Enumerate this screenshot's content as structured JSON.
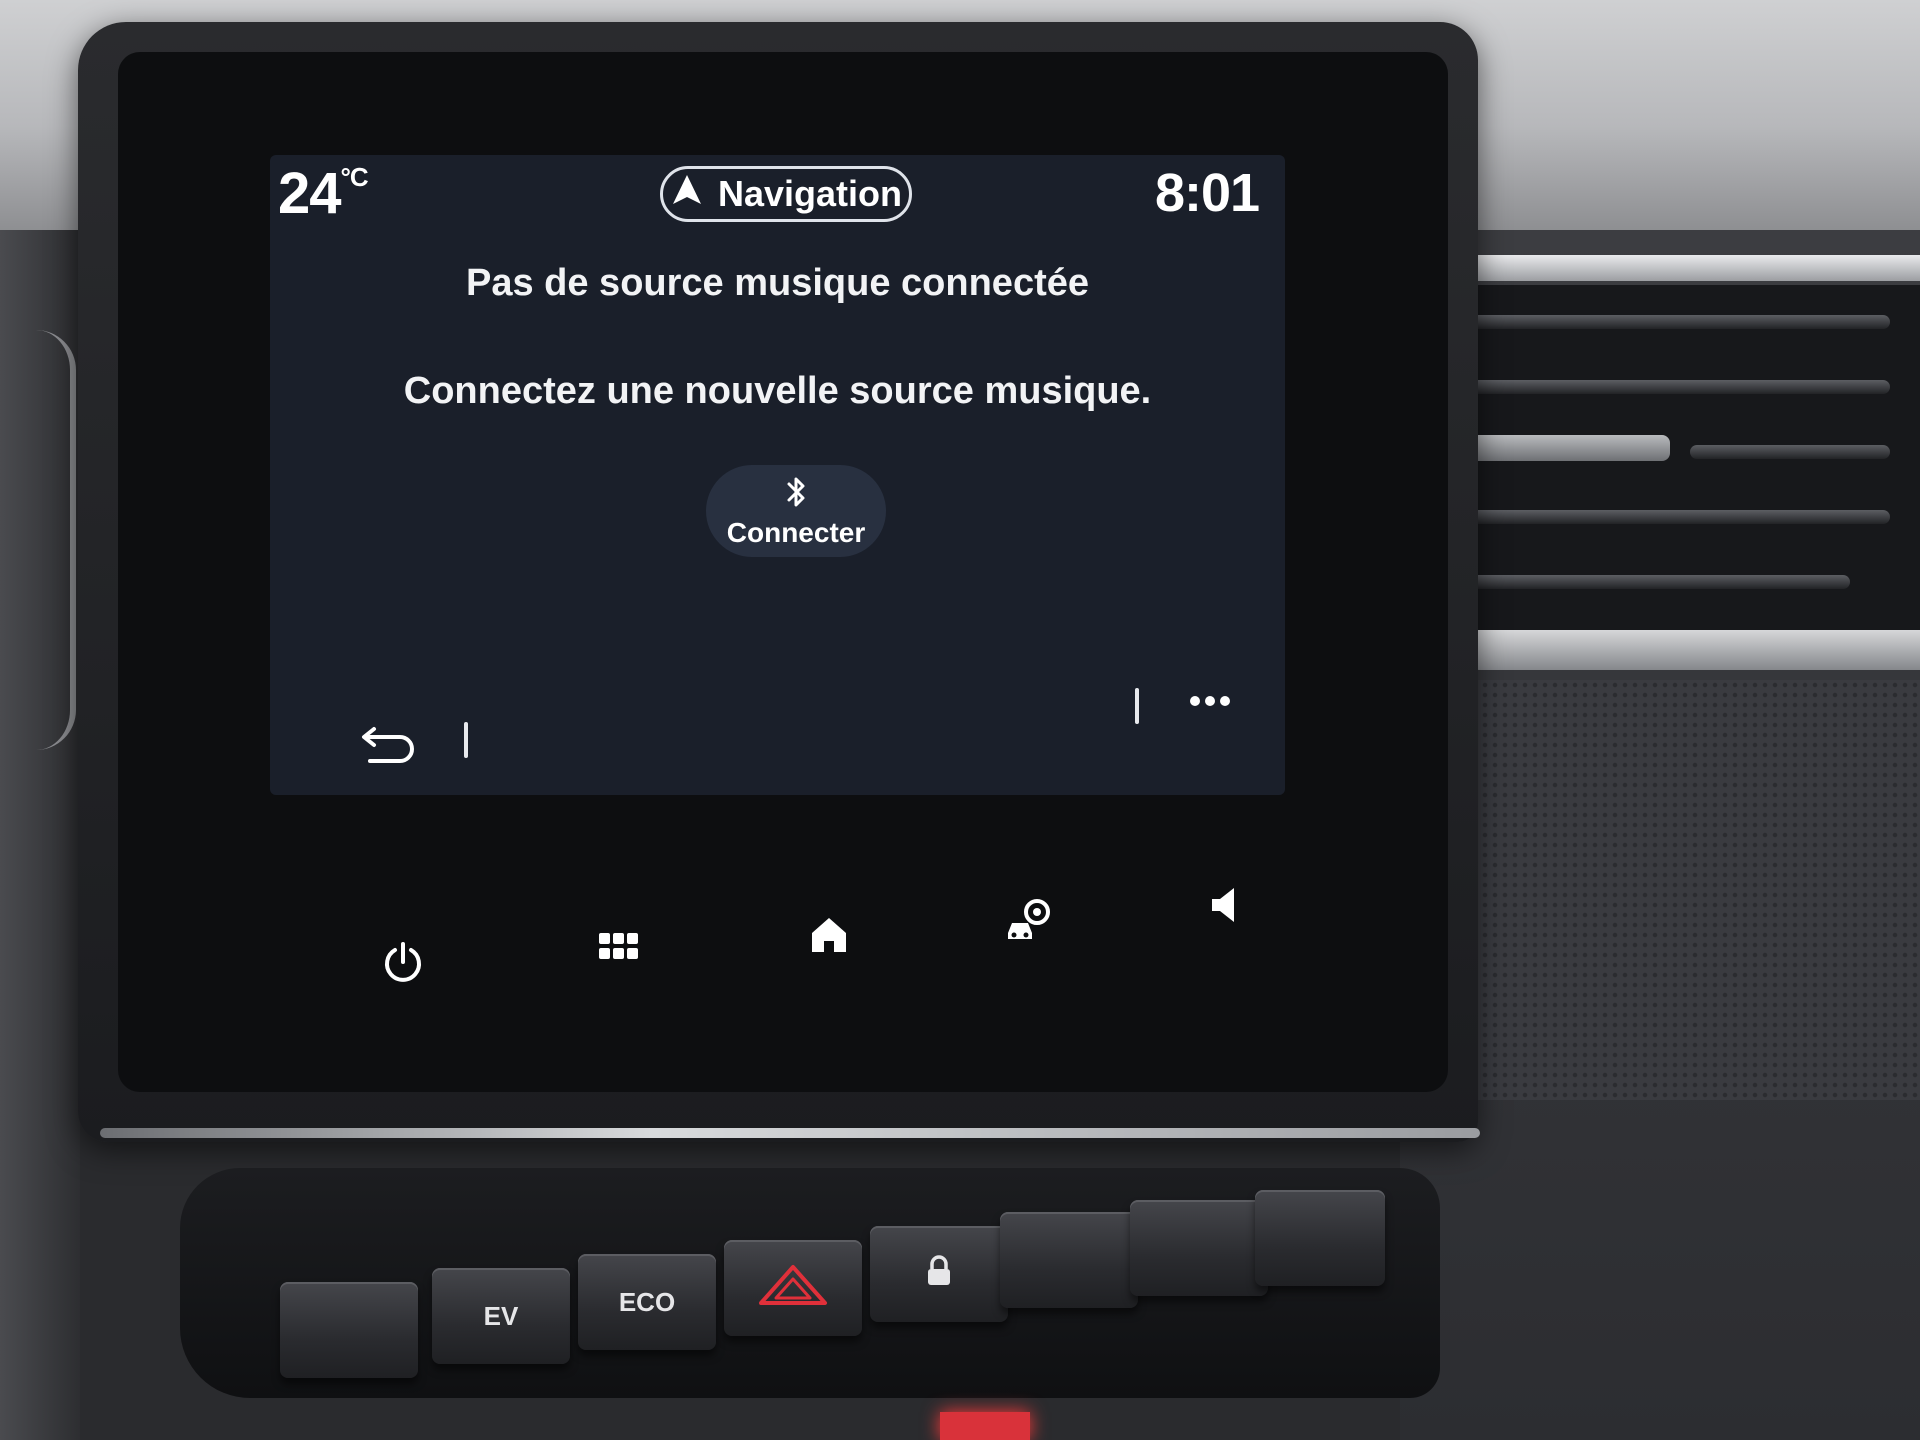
{
  "status_bar": {
    "temperature": "24",
    "temperature_unit": "°C",
    "nav_button_label": "Navigation",
    "clock": "8:01"
  },
  "message": {
    "title": "Pas de source musique connectée",
    "subtitle": "Connectez une nouvelle source musique."
  },
  "connect_button": {
    "label": "Connecter",
    "icon": "bluetooth-icon"
  },
  "bottom_bar": {
    "left_icon": "back-icon",
    "right_icon": "more-options-icon"
  },
  "softkeys": [
    {
      "icon": "power-icon"
    },
    {
      "icon": "apps-grid-icon"
    },
    {
      "icon": "home-icon"
    },
    {
      "icon": "car-settings-icon"
    },
    {
      "icon": "volume-icon"
    }
  ],
  "switches": [
    {
      "label": ""
    },
    {
      "label": "EV"
    },
    {
      "label": "ECO"
    },
    {
      "label": "",
      "icon": "hazard-icon"
    },
    {
      "label": "",
      "icon": "lock-icon"
    },
    {
      "label": ""
    },
    {
      "label": ""
    },
    {
      "label": ""
    }
  ],
  "colors": {
    "display_bg": "#1a1f2a",
    "text": "#ffffff",
    "connect_button_bg": "#283040",
    "hazard": "#e0303a"
  }
}
